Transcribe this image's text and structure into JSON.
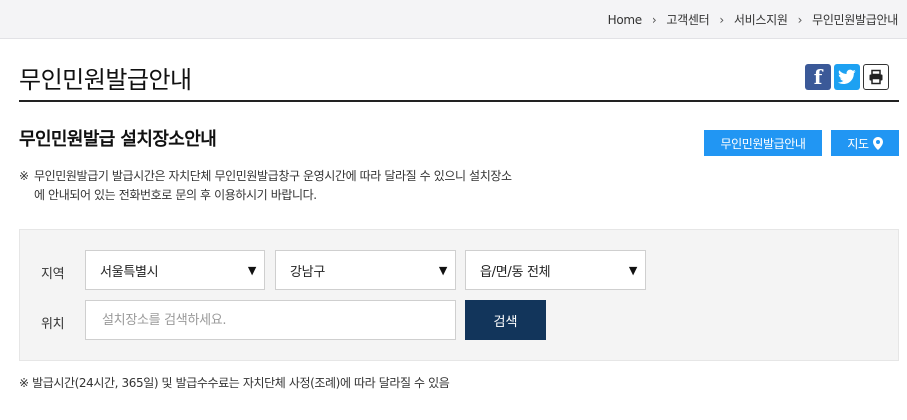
{
  "breadcrumb": [
    "Home",
    "고객센터",
    "서비스지원",
    "무인민원발급안내"
  ],
  "page_title": "무인민원발급안내",
  "share": {
    "facebook_icon": "facebook-icon",
    "twitter_icon": "twitter-icon",
    "print_icon": "print-icon",
    "facebook_color": "#3b5998",
    "twitter_color": "#1da1f2"
  },
  "section_title": "무인민원발급 설치장소안내",
  "tabs": {
    "guide_label": "무인민원발급안내",
    "map_label": "지도",
    "map_icon": "map-marker-icon",
    "accent": "#2196f3"
  },
  "notice": {
    "mark": "※",
    "line1": "무인민원발급기 발급시간은 자치단체 무인민원발급창구 운영시간에 따라 달라질 수 있으니 설치장소",
    "line2": "에 안내되어 있는 전화번호로 문의 후 이용하시기 바랍니다."
  },
  "search": {
    "region_label": "지역",
    "location_label": "위치",
    "sido": "서울특별시",
    "sigungu": "강남구",
    "dong": "읍/면/동 전체",
    "placeholder": "설치장소를 검색하세요.",
    "button_label": "검색",
    "button_color": "#12355b"
  },
  "footnote": "※ 발급시간(24시간, 365일) 및 발급수수료는 자치단체 사정(조례)에 따라 달라질 수 있음"
}
